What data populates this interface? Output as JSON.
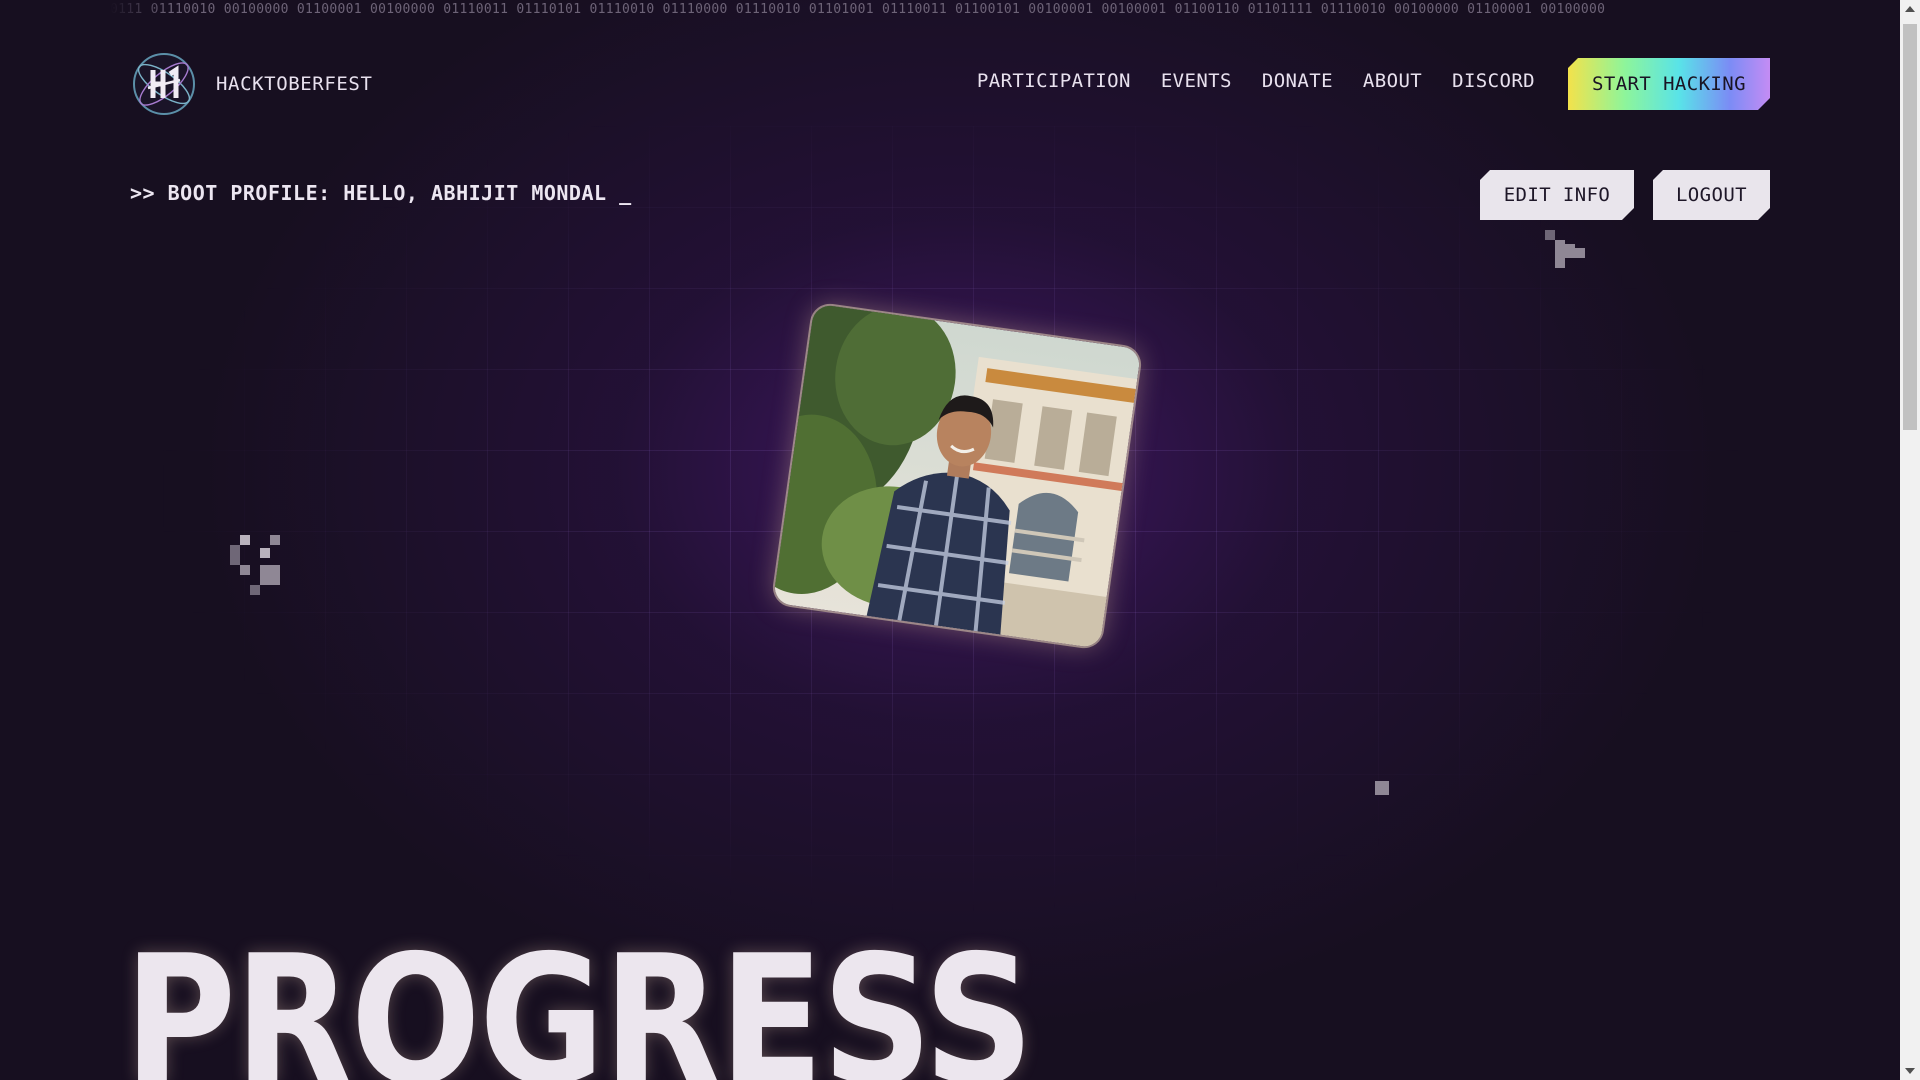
{
  "binary_text": "0111 01110010 00100000 01100001 00100000 01110011 01110101 01110010 01110000 01110010 01101001 01110011 01100101 00100001 00100001 01100110 01101111 01110010 00100000 01100001 00100000",
  "header": {
    "brand": "HACKTOBERFEST",
    "nav": [
      {
        "label": "PARTICIPATION"
      },
      {
        "label": "EVENTS"
      },
      {
        "label": "DONATE"
      },
      {
        "label": "ABOUT"
      },
      {
        "label": "DISCORD"
      }
    ],
    "cta_label": "START HACKING"
  },
  "profile": {
    "boot_line": ">> BOOT PROFILE: HELLO, ABHIJIT MONDAL _",
    "edit_label": "EDIT INFO",
    "logout_label": "LOGOUT"
  },
  "section": {
    "heading": "PROGRESS"
  },
  "colors": {
    "background": "#170f20",
    "glow": "#46186e",
    "text": "#e8e1ee",
    "button_light": "#e9e5ec"
  }
}
